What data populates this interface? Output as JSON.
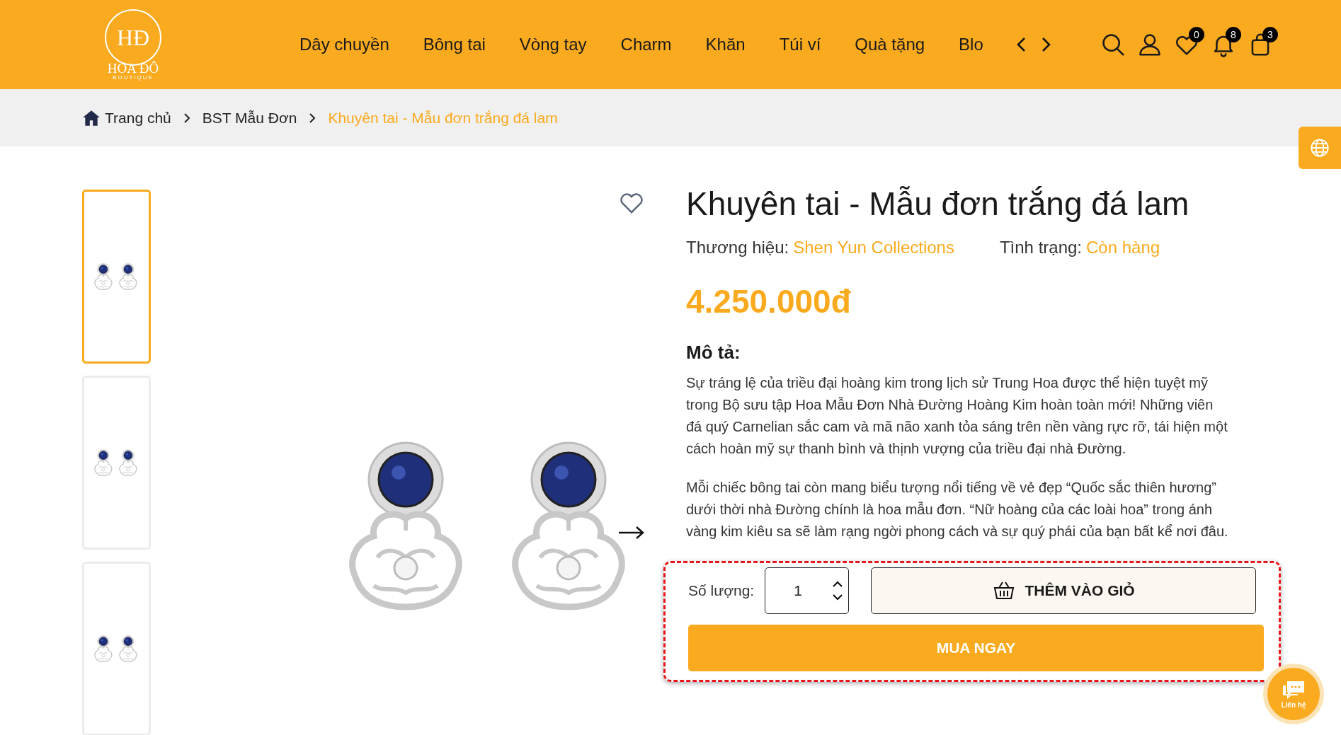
{
  "header": {
    "logo": {
      "monogram": "HĐ",
      "name": "HOA ĐÔ",
      "tagline": "BOUTIQUE"
    },
    "nav": [
      {
        "label": "Dây chuyền"
      },
      {
        "label": "Bông tai"
      },
      {
        "label": "Vòng tay"
      },
      {
        "label": "Charm"
      },
      {
        "label": "Khăn"
      },
      {
        "label": "Túi ví"
      },
      {
        "label": "Quà tặng"
      },
      {
        "label": "Blo"
      }
    ],
    "icons": [
      {
        "kind": "search"
      },
      {
        "kind": "account"
      },
      {
        "kind": "wishlist",
        "badge": "0"
      },
      {
        "kind": "notifications",
        "badge": "8"
      },
      {
        "kind": "cart",
        "badge": "3"
      }
    ]
  },
  "breadcrumb": [
    {
      "label": "Trang chủ",
      "current": false
    },
    {
      "label": "BST Mẫu Đơn",
      "current": false
    },
    {
      "label": "Khuyên tai - Mẫu đơn trắng đá lam",
      "current": true
    }
  ],
  "gallery": {
    "thumbnails": [
      {
        "selected": true
      },
      {
        "selected": false
      },
      {
        "selected": false
      }
    ]
  },
  "product": {
    "title": "Khuyên tai - Mẫu đơn trắng đá lam",
    "brand_label": "Thương hiệu:",
    "brand": "Shen Yun Collections",
    "status_label": "Tình trạng:",
    "status": "Còn hàng",
    "price": "4.250.000đ",
    "description_heading": "Mô tả:",
    "description": [
      "Sự tráng lệ của triều đại hoàng kim trong lịch sử Trung Hoa được thể hiện tuyệt mỹ trong Bộ sưu tập Hoa Mẫu Đơn Nhà Đường Hoàng Kim hoàn toàn mới! Những viên đá quý Carnelian sắc cam và mã não xanh tỏa sáng trên nền vàng rực rỡ, tái hiện một cách hoàn mỹ sự thanh bình và thịnh vượng của triều đại nhà Đường.",
      "Mỗi chiếc bông tai còn mang biểu tượng nổi tiếng về vẻ đẹp “Quốc sắc thiên hương” dưới thời nhà Đường chính là hoa mẫu đơn. “Nữ hoàng của các loài hoa” trong ánh vàng kim kiêu sa sẽ làm rạng ngời phong cách và sự quý phái của bạn bất kể nơi đâu."
    ],
    "quantity_label": "Số lượng:",
    "quantity": "1",
    "add_to_cart": "THÊM VÀO GIỎ",
    "buy_now": "MUA NGAY"
  },
  "chat": {
    "label": "Liên hệ"
  }
}
